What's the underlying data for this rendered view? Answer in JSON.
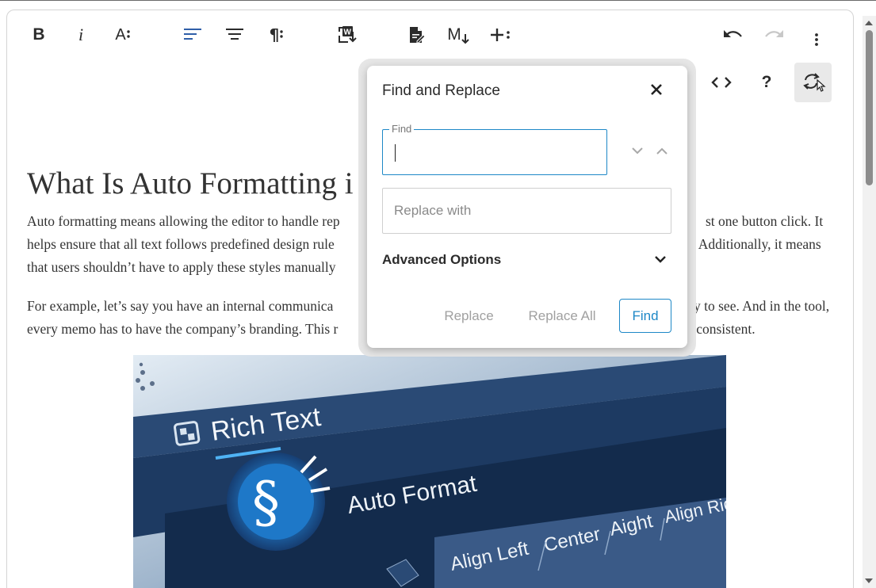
{
  "toolbar": {
    "bold_label": "B",
    "italic_label": "i",
    "font_size_label": "A",
    "paragraph_format_label": "¶",
    "markdown_label": "M"
  },
  "secondary_toolbar": {
    "help_label": "?"
  },
  "document": {
    "title": "What Is Auto Formatting i",
    "para1_line1_left": "Auto formatting means allowing the editor to handle rep",
    "para1_line1_right": "st one button click. It",
    "para1_line2_left": "helps ensure that all text follows predefined design rule",
    "para1_line2_right": ". Additionally, it means",
    "para1_line3_left": "that users shouldn’t have to apply these styles manually",
    "para2_line1_left": "For example, let’s say you have an internal communica",
    "para2_line1_right": "y to see. And in the tool,",
    "para2_line2_left": "every memo has to have the company’s branding. This r",
    "para2_line2_right": "r consistent."
  },
  "image": {
    "rich_text_label": "Rich Text",
    "auto_format_label": "Auto Format",
    "align_left_label": "Align Left",
    "center_label": "Center",
    "aight_label": "Aight",
    "align_right_label": "Align Rig",
    "section_glyph": "§"
  },
  "dialog": {
    "title": "Find and Replace",
    "find_label": "Find",
    "find_value": "",
    "replace_placeholder": "Replace with",
    "advanced_label": "Advanced Options",
    "replace_button": "Replace",
    "replace_all_button": "Replace All",
    "find_button": "Find"
  },
  "colors": {
    "accent": "#1e88c7",
    "toolbar_icon": "#2b2b2b",
    "align_left_icon": "#2f5fa8"
  },
  "icons": {
    "bold": "bold-icon",
    "italic": "italic-icon",
    "font_size": "font-size-icon",
    "align_left": "align-left-icon",
    "align_center": "align-center-icon",
    "paragraph_format": "paragraph-format-icon",
    "import_word": "import-word-icon",
    "export_pdf": "export-document-icon",
    "markdown": "markdown-icon",
    "insert_more": "insert-more-icon",
    "undo": "undo-icon",
    "redo": "redo-icon",
    "more_menu": "more-vertical-icon",
    "code_view": "code-view-icon",
    "help": "help-icon",
    "find_replace": "find-replace-icon",
    "close": "close-icon"
  }
}
